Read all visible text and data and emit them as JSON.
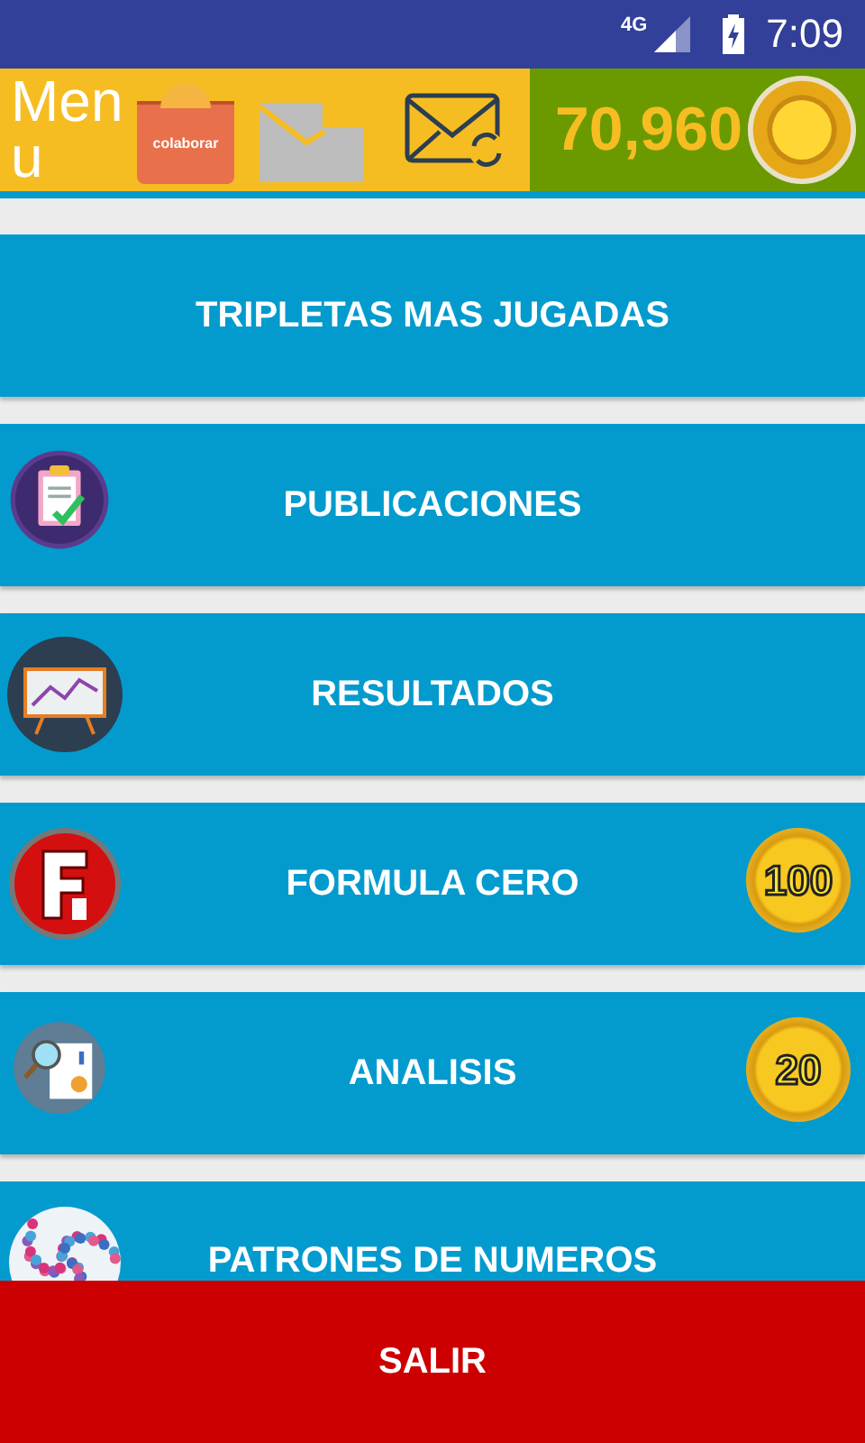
{
  "status_bar": {
    "network": "4G",
    "time": "7:09"
  },
  "header": {
    "menu_label": "Menu",
    "donate_label": "colaborar",
    "coins": "70,960"
  },
  "menu_items": [
    {
      "label": "TRIPLETAS MAS JUGADAS",
      "kind": "none"
    },
    {
      "label": "PUBLICACIONES",
      "kind": "clipboard"
    },
    {
      "label": "RESULTADOS",
      "kind": "presentation"
    },
    {
      "label": "FORMULA CERO",
      "kind": "formula",
      "badge": "100"
    },
    {
      "label": "ANALISIS",
      "kind": "analysis",
      "badge": "20"
    },
    {
      "label": "PATRONES DE NUMEROS",
      "kind": "numbers"
    }
  ],
  "footer_button": "SALIR"
}
